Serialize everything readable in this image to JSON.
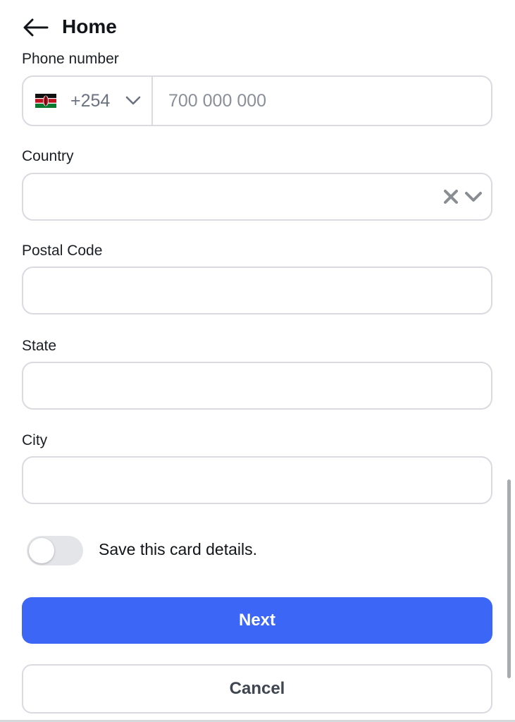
{
  "header": {
    "title": "Home",
    "back_icon": "arrow-left-icon"
  },
  "phone": {
    "label": "Phone number",
    "flag_icon": "kenya-flag-icon",
    "dial_code": "+254",
    "placeholder": "700 000 000",
    "value": ""
  },
  "country": {
    "label": "Country",
    "value": "",
    "clear_icon": "close-icon",
    "dropdown_icon": "chevron-down-icon"
  },
  "postal_code": {
    "label": "Postal Code",
    "value": ""
  },
  "state": {
    "label": "State",
    "value": ""
  },
  "city": {
    "label": "City",
    "value": ""
  },
  "save_card": {
    "label": "Save this card details.",
    "enabled": false
  },
  "actions": {
    "next_label": "Next",
    "cancel_label": "Cancel"
  },
  "colors": {
    "primary": "#3c66f5",
    "border": "#d9dbe0",
    "toggle_off": "#e4e5e8"
  }
}
